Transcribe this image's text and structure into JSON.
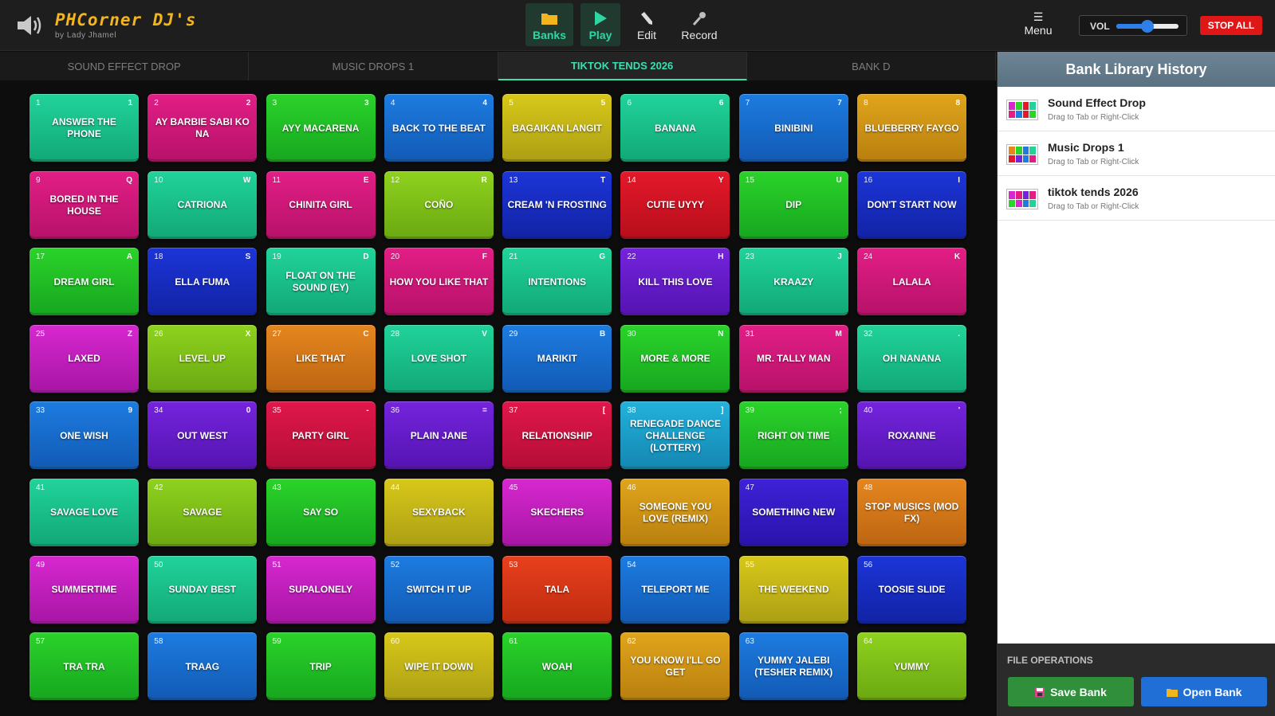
{
  "app": {
    "title": "PHCorner DJ's",
    "subtitle": "by Lady Jhamel"
  },
  "nav": {
    "banks": "Banks",
    "play": "Play",
    "edit": "Edit",
    "record": "Record",
    "menu_icon": "☰",
    "menu": "Menu",
    "vol_label": "VOL",
    "volume": 0.5,
    "stop_all": "STOP ALL"
  },
  "tabs": [
    {
      "label": "SOUND EFFECT DROP"
    },
    {
      "label": "MUSIC DROPS 1"
    },
    {
      "label": "TIKTOK TENDS 2026",
      "active": true
    },
    {
      "label": "BANK D"
    }
  ],
  "pads": [
    {
      "n": "1",
      "k": "1",
      "name": "ANSWER THE PHONE",
      "c": "teal"
    },
    {
      "n": "2",
      "k": "2",
      "name": "AY BARBIE SABI KO NA",
      "c": "pink"
    },
    {
      "n": "3",
      "k": "3",
      "name": "AYY MACARENA",
      "c": "green"
    },
    {
      "n": "4",
      "k": "4",
      "name": "BACK TO THE BEAT",
      "c": "blue"
    },
    {
      "n": "5",
      "k": "5",
      "name": "BAGAIKAN LANGIT",
      "c": "yellow"
    },
    {
      "n": "6",
      "k": "6",
      "name": "BANANA",
      "c": "teal"
    },
    {
      "n": "7",
      "k": "7",
      "name": "BINIBINI",
      "c": "blue"
    },
    {
      "n": "8",
      "k": "8",
      "name": "BLUEBERRY FAYGO",
      "c": "mustard"
    },
    {
      "n": "9",
      "k": "Q",
      "name": "BORED IN THE HOUSE",
      "c": "pink"
    },
    {
      "n": "10",
      "k": "W",
      "name": "CATRIONA",
      "c": "teal"
    },
    {
      "n": "11",
      "k": "E",
      "name": "CHINITA GIRL",
      "c": "pink"
    },
    {
      "n": "12",
      "k": "R",
      "name": "COÑO",
      "c": "lime"
    },
    {
      "n": "13",
      "k": "T",
      "name": "CREAM 'N FROSTING",
      "c": "navy"
    },
    {
      "n": "14",
      "k": "Y",
      "name": "CUTIE UYYY",
      "c": "red"
    },
    {
      "n": "15",
      "k": "U",
      "name": "DIP",
      "c": "green"
    },
    {
      "n": "16",
      "k": "I",
      "name": "DON'T START NOW",
      "c": "navy"
    },
    {
      "n": "17",
      "k": "A",
      "name": "DREAM GIRL",
      "c": "green"
    },
    {
      "n": "18",
      "k": "S",
      "name": "ELLA FUMA",
      "c": "navy"
    },
    {
      "n": "19",
      "k": "D",
      "name": "FLOAT ON THE SOUND (EY)",
      "c": "teal"
    },
    {
      "n": "20",
      "k": "F",
      "name": "HOW YOU LIKE THAT",
      "c": "pink"
    },
    {
      "n": "21",
      "k": "G",
      "name": "INTENTIONS",
      "c": "teal"
    },
    {
      "n": "22",
      "k": "H",
      "name": "KILL THIS LOVE",
      "c": "purple"
    },
    {
      "n": "23",
      "k": "J",
      "name": "KRAAZY",
      "c": "teal"
    },
    {
      "n": "24",
      "k": "K",
      "name": "LALALA",
      "c": "pink"
    },
    {
      "n": "25",
      "k": "Z",
      "name": "LAXED",
      "c": "magenta"
    },
    {
      "n": "26",
      "k": "X",
      "name": "LEVEL UP",
      "c": "lime"
    },
    {
      "n": "27",
      "k": "C",
      "name": "LIKE THAT",
      "c": "orange"
    },
    {
      "n": "28",
      "k": "V",
      "name": "LOVE SHOT",
      "c": "teal"
    },
    {
      "n": "29",
      "k": "B",
      "name": "MARIKIT",
      "c": "blue"
    },
    {
      "n": "30",
      "k": "N",
      "name": "MORE & MORE",
      "c": "green"
    },
    {
      "n": "31",
      "k": "M",
      "name": "MR. TALLY MAN",
      "c": "pink"
    },
    {
      "n": "32",
      "k": ".",
      "name": "OH NANANA",
      "c": "teal"
    },
    {
      "n": "33",
      "k": "9",
      "name": "ONE WISH",
      "c": "blue"
    },
    {
      "n": "34",
      "k": "0",
      "name": "OUT WEST",
      "c": "purple"
    },
    {
      "n": "35",
      "k": "-",
      "name": "PARTY GIRL",
      "c": "crimson"
    },
    {
      "n": "36",
      "k": "=",
      "name": "PLAIN JANE",
      "c": "purple"
    },
    {
      "n": "37",
      "k": "[",
      "name": "RELATIONSHIP",
      "c": "crimson"
    },
    {
      "n": "38",
      "k": "]",
      "name": "RENEGADE DANCE CHALLENGE (LOTTERY)",
      "c": "sky"
    },
    {
      "n": "39",
      "k": ";",
      "name": "RIGHT ON TIME",
      "c": "green"
    },
    {
      "n": "40",
      "k": "'",
      "name": "ROXANNE",
      "c": "purple"
    },
    {
      "n": "41",
      "k": "",
      "name": "SAVAGE LOVE",
      "c": "teal"
    },
    {
      "n": "42",
      "k": "",
      "name": "SAVAGE",
      "c": "lime"
    },
    {
      "n": "43",
      "k": "",
      "name": "SAY SO",
      "c": "green"
    },
    {
      "n": "44",
      "k": "",
      "name": "SEXYBACK",
      "c": "yellow"
    },
    {
      "n": "45",
      "k": "",
      "name": "SKECHERS",
      "c": "magenta"
    },
    {
      "n": "46",
      "k": "",
      "name": "SOMEONE YOU LOVE (REMIX)",
      "c": "mustard"
    },
    {
      "n": "47",
      "k": "",
      "name": "SOMETHING NEW",
      "c": "indigo"
    },
    {
      "n": "48",
      "k": "",
      "name": "STOP MUSICS (MOD FX)",
      "c": "orange"
    },
    {
      "n": "49",
      "k": "",
      "name": "SUMMERTIME",
      "c": "magenta"
    },
    {
      "n": "50",
      "k": "",
      "name": "SUNDAY BEST",
      "c": "teal"
    },
    {
      "n": "51",
      "k": "",
      "name": "SUPALONELY",
      "c": "magenta"
    },
    {
      "n": "52",
      "k": "",
      "name": "SWITCH IT UP",
      "c": "blue"
    },
    {
      "n": "53",
      "k": "",
      "name": "TALA",
      "c": "redorange"
    },
    {
      "n": "54",
      "k": "",
      "name": "TELEPORT ME",
      "c": "blue"
    },
    {
      "n": "55",
      "k": "",
      "name": "THE WEEKEND",
      "c": "yellow"
    },
    {
      "n": "56",
      "k": "",
      "name": "TOOSIE SLIDE",
      "c": "navy"
    },
    {
      "n": "57",
      "k": "",
      "name": "TRA TRA",
      "c": "green"
    },
    {
      "n": "58",
      "k": "",
      "name": "TRAAG",
      "c": "blue"
    },
    {
      "n": "59",
      "k": "",
      "name": "TRIP",
      "c": "green"
    },
    {
      "n": "60",
      "k": "",
      "name": "WIPE IT DOWN",
      "c": "yellow"
    },
    {
      "n": "61",
      "k": "",
      "name": "WOAH",
      "c": "green"
    },
    {
      "n": "62",
      "k": "",
      "name": "YOU KNOW I'LL GO GET",
      "c": "mustard"
    },
    {
      "n": "63",
      "k": "",
      "name": "YUMMY JALEBI (TESHER REMIX)",
      "c": "blue"
    },
    {
      "n": "64",
      "k": "",
      "name": "YUMMY",
      "c": "lime"
    }
  ],
  "library": {
    "title": "Bank Library History",
    "items": [
      {
        "title": "Sound Effect Drop",
        "sub": "Drag to Tab or Right-Click",
        "colors": [
          "#d728d0",
          "#2bd32a",
          "#e5182a",
          "#21d39a",
          "#e21e86",
          "#1d7ce0",
          "#e5182a",
          "#2bd32a"
        ]
      },
      {
        "title": "Music Drops 1",
        "sub": "Drag to Tab or Right-Click",
        "colors": [
          "#e5861f",
          "#2bd32a",
          "#1d7ce0",
          "#21d39a",
          "#e5182a",
          "#7424dd",
          "#1d7ce0",
          "#e21e86"
        ]
      },
      {
        "title": "tiktok tends 2026",
        "sub": "Drag to Tab or Right-Click",
        "colors": [
          "#d728d0",
          "#e21e86",
          "#7424dd",
          "#e21e86",
          "#2bd32a",
          "#d728d0",
          "#1d7ce0",
          "#21d39a"
        ]
      }
    ]
  },
  "file_ops": {
    "label": "FILE OPERATIONS",
    "save": "Save Bank",
    "open": "Open Bank"
  },
  "colors": {
    "accent": "#38e0b0",
    "stop": "#e01717",
    "title": "#f2b51d",
    "save": "#2f8f3a",
    "open": "#1f6fd6"
  },
  "icons": {
    "logo": "speaker-icon",
    "banks": "folder-icon",
    "play": "play-icon",
    "edit": "pencil-icon",
    "record": "microphone-icon",
    "menu": "hamburger-icon",
    "save": "floppy-disk-icon",
    "open": "folder-icon"
  }
}
